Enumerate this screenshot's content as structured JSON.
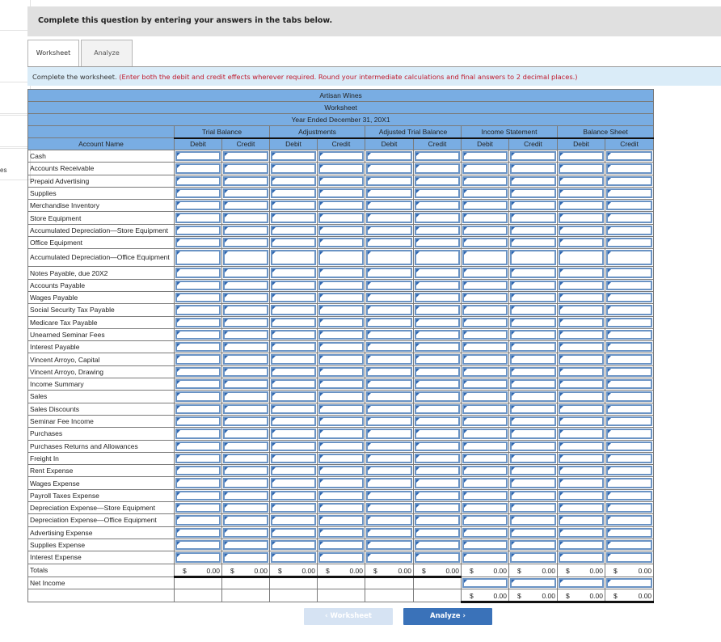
{
  "side_hint_text": "es",
  "banner": {
    "text": "Complete this question by entering your answers in the tabs below."
  },
  "tabs": [
    {
      "label": "Worksheet",
      "active": true
    },
    {
      "label": "Analyze",
      "active": false
    }
  ],
  "instructions": {
    "main": "Complete the worksheet.",
    "note": "(Enter both the debit and credit effects wherever required. Round your intermediate calculations and final answers to 2 decimal places.)"
  },
  "worksheet": {
    "company": "Artisan Wines",
    "title": "Worksheet",
    "period": "Year Ended December 31, 20X1",
    "account_header": "Account Name",
    "column_groups": [
      "Trial Balance",
      "Adjustments",
      "Adjusted Trial Balance",
      "Income Statement",
      "Balance Sheet"
    ],
    "subcolumns": [
      "Debit",
      "Credit",
      "Debit",
      "Credit",
      "Debit",
      "Credit",
      "Debit",
      "Credit",
      "Debit",
      "Credit"
    ],
    "accounts": [
      "Cash",
      "Accounts Receivable",
      "Prepaid Advertising",
      "Supplies",
      "Merchandise Inventory",
      "Store Equipment",
      "Accumulated Depreciation—Store Equipment",
      "Office Equipment",
      "Accumulated Depreciation—Office Equipment",
      "Notes Payable, due 20X2",
      "Accounts Payable",
      "Wages Payable",
      "Social Security Tax Payable",
      "Medicare Tax Payable",
      "Unearned Seminar Fees",
      "Interest Payable",
      "Vincent Arroyo, Capital",
      "Vincent Arroyo, Drawing",
      "Income Summary",
      "Sales",
      "Sales Discounts",
      "Seminar Fee Income",
      "Purchases",
      "Purchases Returns and Allowances",
      "Freight In",
      "Rent Expense",
      "Wages Expense",
      "Payroll Taxes Expense",
      "Depreciation Expense—Store Equipment",
      "Depreciation Expense—Office Equipment",
      "Advertising Expense",
      "Supplies Expense",
      "Interest Expense"
    ],
    "totals_label": "Totals",
    "currency_symbol": "$",
    "totals": [
      "0.00",
      "0.00",
      "0.00",
      "0.00",
      "0.00",
      "0.00",
      "0.00",
      "0.00",
      "0.00",
      "0.00"
    ],
    "net_income_label": "Net Income",
    "final_totals": [
      "0.00",
      "0.00",
      "0.00",
      "0.00"
    ]
  },
  "nav": {
    "prev_label": "‹  Worksheet",
    "next_label": "Analyze  ›"
  }
}
